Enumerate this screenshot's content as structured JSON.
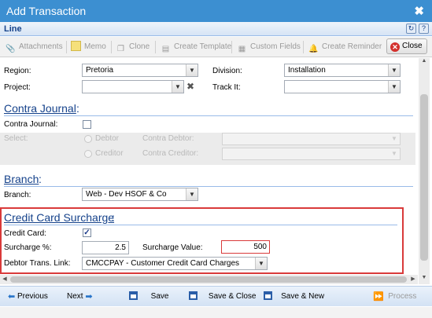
{
  "window": {
    "title": "Add Transaction",
    "close_glyph": "✖"
  },
  "panel": {
    "title": "Line"
  },
  "toolbar": {
    "attachments": "Attachments",
    "memo": "Memo",
    "clone": "Clone",
    "create_template": "Create Template",
    "custom_fields": "Custom Fields",
    "create_reminder": "Create Reminder",
    "close": "Close"
  },
  "form": {
    "region_label": "Region:",
    "region_value": "Pretoria",
    "division_label": "Division:",
    "division_value": "Installation",
    "project_label": "Project:",
    "project_value": "",
    "track_label": "Track It:",
    "track_value": ""
  },
  "contra": {
    "heading": "Contra Journal",
    "journal_label": "Contra Journal:",
    "journal_checked": false,
    "select_label": "Select:",
    "debtor_label": "Debtor",
    "creditor_label": "Creditor",
    "contra_debtor_label": "Contra Debtor:",
    "contra_creditor_label": "Contra Creditor:"
  },
  "branch": {
    "heading": "Branch",
    "label": "Branch:",
    "value": "Web - Dev HSOF & Co"
  },
  "surcharge": {
    "heading": "Credit Card Surcharge",
    "credit_card_label": "Credit Card:",
    "credit_card_checked": true,
    "pct_label": "Surcharge %:",
    "pct_value": "2.5",
    "value_label": "Surcharge Value:",
    "value_value": "500",
    "link_label": "Debtor Trans. Link:",
    "link_value": "CMCCPAY - Customer Credit Card Charges"
  },
  "footer": {
    "previous": "Previous",
    "next": "Next",
    "save": "Save",
    "save_close": "Save & Close",
    "save_new": "Save & New",
    "process": "Process"
  },
  "colors": {
    "title_bar": "#3c8fd1",
    "section_heading": "#15428b",
    "highlight_border": "#d93a3a",
    "close_icon": "#d3302c"
  }
}
